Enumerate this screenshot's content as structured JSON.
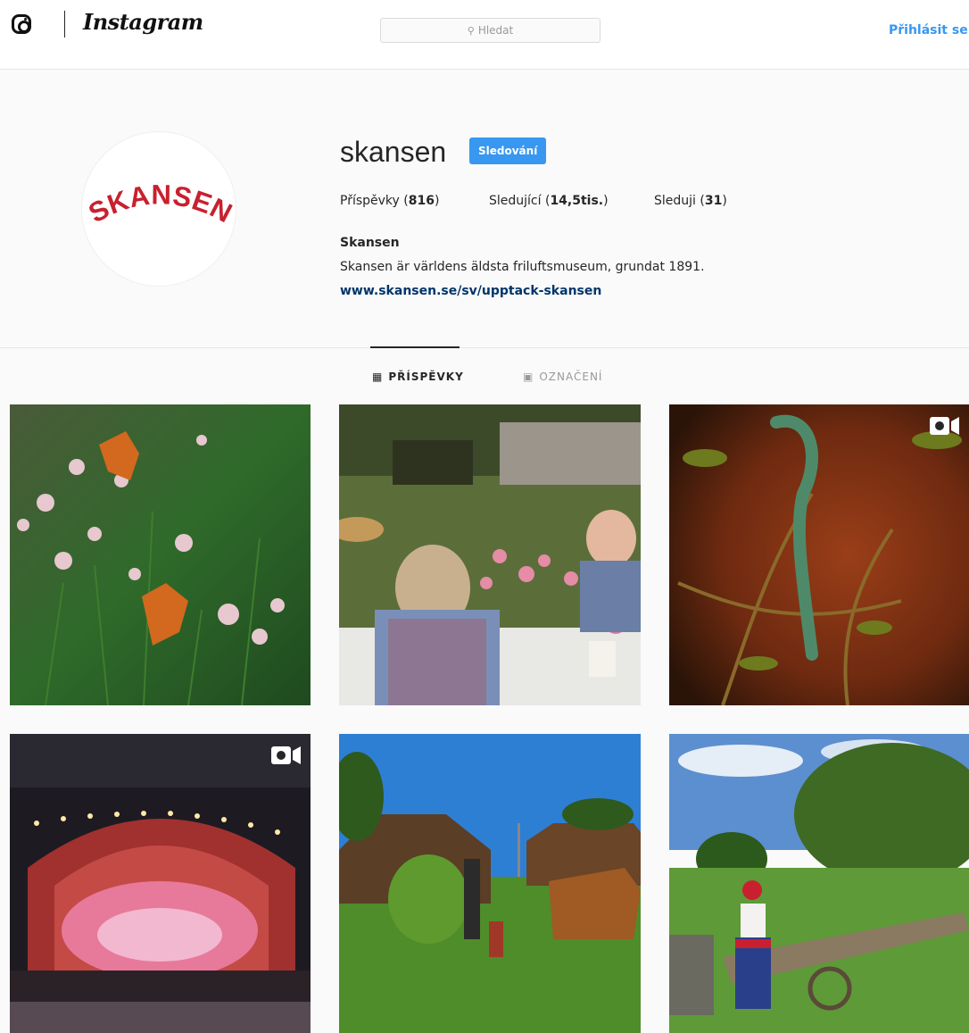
{
  "header": {
    "brand_name": "Instagram",
    "search_placeholder": "Hledat",
    "login_label": "Přihlásit se"
  },
  "profile": {
    "avatar_logo_text": "SKANSEN",
    "username": "skansen",
    "follow_label": "Sledování",
    "stats": {
      "posts_label": "Příspěvky",
      "posts_count": "816",
      "followers_label": "Sledující",
      "followers_count": "14,5tis.",
      "following_label": "Sleduji",
      "following_count": "31"
    },
    "full_name": "Skansen",
    "bio": "Skansen är världens äldsta friluftsmuseum, grundat 1891.",
    "website": "www.skansen.se/sv/upptack-skansen"
  },
  "tabs": [
    {
      "label": "PŘÍSPĚVKY",
      "icon": "grid-icon",
      "active": true
    },
    {
      "label": "OZNAČENÍ",
      "icon": "tagged-person-icon",
      "active": false
    }
  ],
  "posts": [
    {
      "subject": "butterflies-on-flowers",
      "video": false
    },
    {
      "subject": "people-having-coffee-in-garden",
      "video": false
    },
    {
      "subject": "chameleon-on-branch",
      "video": true
    },
    {
      "subject": "concert-stage",
      "video": true
    },
    {
      "subject": "horse-and-hay-farm",
      "video": false
    },
    {
      "subject": "girl-in-folk-costume",
      "video": false
    }
  ],
  "colors": {
    "accent": "#3897f0",
    "link": "#003569",
    "logo_red": "#c8202f"
  }
}
